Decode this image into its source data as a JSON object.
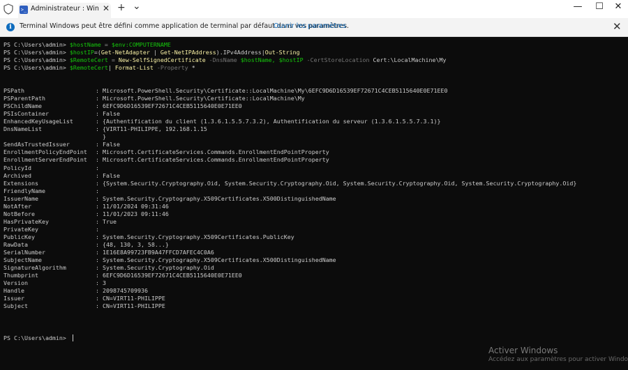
{
  "window": {
    "tab_title": "Administrateur : Windows PowerShell",
    "new_tab": "+",
    "dropdown": "⌄",
    "minimize": "—",
    "maximize": "☐",
    "close": "✕"
  },
  "infobar": {
    "message": "Terminal Windows peut être défini comme application de terminal par défaut dans vos paramètres.",
    "link": "Ouvrir les paramètres",
    "close": "✕"
  },
  "commands": [
    {
      "prompt": "PS C:\\Users\\admin> ",
      "v1": "$hostName",
      "op1": " = ",
      "v2": "$env:COMPUTERNAME"
    },
    {
      "prompt": "PS C:\\Users\\admin> ",
      "v1": "$hostIP",
      "op1": "=(",
      "c1": "Get-NetAdapter",
      "op2": " | ",
      "c2": "Get-NetIPAddress",
      "rest": ").IPv4Address|",
      "c3": "Out-String"
    },
    {
      "prompt": "PS C:\\Users\\admin> ",
      "v1": "$RemoteCert",
      "op1": " = ",
      "c1": "New-SelfSignedCertificate",
      "p1": " -DnsName ",
      "v2": "$hostName,",
      "sp": " ",
      "v3": "$hostIP",
      "p2": " -CertStoreLocation ",
      "rest": "Cert:\\LocalMachine\\My"
    },
    {
      "prompt": "PS C:\\Users\\admin> ",
      "v1": "$RemoteCert",
      "rest": "| ",
      "c1": "Format-List",
      "p1": " -Property ",
      "rest2": "*"
    }
  ],
  "properties": [
    {
      "name": "PSPath",
      "sep": ":",
      "value": "Microsoft.PowerShell.Security\\Certificate::LocalMachine\\My\\6EFC9D6D16539EF72671C4CEB5115640E0E71EE0"
    },
    {
      "name": "PSParentPath",
      "sep": ":",
      "value": "Microsoft.PowerShell.Security\\Certificate::LocalMachine\\My"
    },
    {
      "name": "PSChildName",
      "sep": ":",
      "value": "6EFC9D6D16539EF72671C4CEB5115640E0E71EE0"
    },
    {
      "name": "PSIsContainer",
      "sep": ":",
      "value": "False"
    },
    {
      "name": "EnhancedKeyUsageList",
      "sep": ":",
      "value": "{Authentification du client (1.3.6.1.5.5.7.3.2), Authentification du serveur (1.3.6.1.5.5.7.3.1)}"
    },
    {
      "name": "DnsNameList",
      "sep": ":",
      "value": "{VIRT11-PHILIPPE, 192.168.1.15"
    },
    {
      "name": "",
      "sep": "",
      "value": "}"
    },
    {
      "name": "SendAsTrustedIssuer",
      "sep": ":",
      "value": "False"
    },
    {
      "name": "EnrollmentPolicyEndPoint",
      "sep": ":",
      "value": "Microsoft.CertificateServices.Commands.EnrollmentEndPointProperty"
    },
    {
      "name": "EnrollmentServerEndPoint",
      "sep": ":",
      "value": "Microsoft.CertificateServices.Commands.EnrollmentEndPointProperty"
    },
    {
      "name": "PolicyId",
      "sep": ":",
      "value": ""
    },
    {
      "name": "Archived",
      "sep": ":",
      "value": "False"
    },
    {
      "name": "Extensions",
      "sep": ":",
      "value": "{System.Security.Cryptography.Oid, System.Security.Cryptography.Oid, System.Security.Cryptography.Oid, System.Security.Cryptography.Oid}"
    },
    {
      "name": "FriendlyName",
      "sep": ":",
      "value": ""
    },
    {
      "name": "IssuerName",
      "sep": ":",
      "value": "System.Security.Cryptography.X509Certificates.X500DistinguishedName"
    },
    {
      "name": "NotAfter",
      "sep": ":",
      "value": "11/01/2024 09:31:46"
    },
    {
      "name": "NotBefore",
      "sep": ":",
      "value": "11/01/2023 09:11:46"
    },
    {
      "name": "HasPrivateKey",
      "sep": ":",
      "value": "True"
    },
    {
      "name": "PrivateKey",
      "sep": ":",
      "value": ""
    },
    {
      "name": "PublicKey",
      "sep": ":",
      "value": "System.Security.Cryptography.X509Certificates.PublicKey"
    },
    {
      "name": "RawData",
      "sep": ":",
      "value": "{48, 130, 3, 58...}"
    },
    {
      "name": "SerialNumber",
      "sep": ":",
      "value": "1E16E8A99723FB9A47FFCD7AFEC4C0A6"
    },
    {
      "name": "SubjectName",
      "sep": ":",
      "value": "System.Security.Cryptography.X509Certificates.X500DistinguishedName"
    },
    {
      "name": "SignatureAlgorithm",
      "sep": ":",
      "value": "System.Security.Cryptography.Oid"
    },
    {
      "name": "Thumbprint",
      "sep": ":",
      "value": "6EFC9D6D16539EF72671C4CEB5115640E0E71EE0"
    },
    {
      "name": "Version",
      "sep": ":",
      "value": "3"
    },
    {
      "name": "Handle",
      "sep": ":",
      "value": "2098745709936"
    },
    {
      "name": "Issuer",
      "sep": ":",
      "value": "CN=VIRT11-PHILIPPE"
    },
    {
      "name": "Subject",
      "sep": ":",
      "value": "CN=VIRT11-PHILIPPE"
    }
  ],
  "final_prompt": "PS C:\\Users\\admin> ",
  "watermark": {
    "title": "Activer Windows",
    "subtitle": "Accédez aux paramètres pour activer Windows."
  }
}
